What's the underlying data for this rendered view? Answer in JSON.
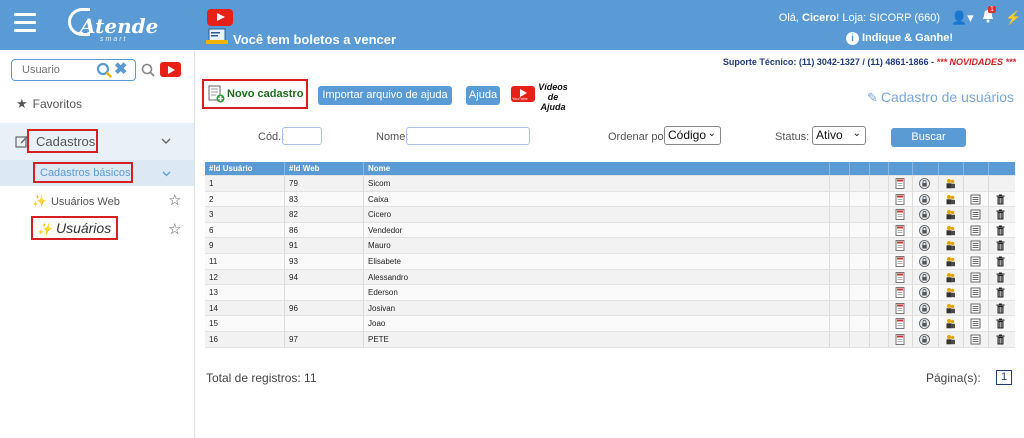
{
  "header": {
    "logo_text": "Atende",
    "logo_sub": "smart",
    "boleto_text": "Você tem boletos a vencer",
    "greeting_prefix": "Olá,",
    "user_name": "Cicero",
    "greeting_suffix": "! Loja: SICORP (660)",
    "notification_count": "1",
    "indique_text": "Indique & Ganhe!"
  },
  "sidebar": {
    "search_placeholder": "Usuario",
    "favoritos": "Favoritos",
    "cadastros": "Cadastros",
    "cadastros_basicos": "Cadastros básicos",
    "items": [
      {
        "label": "Usuários Web"
      },
      {
        "label": "Usuários"
      }
    ]
  },
  "support": {
    "text": "Suporte Técnico: (11) 3042-1327 / (11) 4861-1866 - ",
    "novidades": "*** NOVIDADES ***"
  },
  "toolbar": {
    "novo": "Novo cadastro",
    "importar": "Importar arquivo de ajuda",
    "ajuda": "Ajuda",
    "videos_line1": "Vídeos",
    "videos_line2": "de Ajuda",
    "youtube": "YouTube"
  },
  "page_title": "Cadastro de usuários",
  "filters": {
    "cod_label": "Cód.:",
    "cod_value": "",
    "nome_label": "Nome:",
    "nome_value": "",
    "ordenar_label": "Ordenar por:",
    "ordenar_value": "Código",
    "status_label": "Status:",
    "status_value": "Ativo",
    "buscar": "Buscar"
  },
  "table": {
    "columns": [
      "#Id Usuário",
      "#Id Web",
      "Nome"
    ],
    "rows": [
      {
        "id": "1",
        "web": "79",
        "nome": "Sicom",
        "full": false
      },
      {
        "id": "2",
        "web": "83",
        "nome": "Caixa",
        "full": true
      },
      {
        "id": "3",
        "web": "82",
        "nome": "Cicero",
        "full": true
      },
      {
        "id": "6",
        "web": "86",
        "nome": "Vendedor",
        "full": true
      },
      {
        "id": "9",
        "web": "91",
        "nome": "Mauro",
        "full": true
      },
      {
        "id": "11",
        "web": "93",
        "nome": "Elisabete",
        "full": true
      },
      {
        "id": "12",
        "web": "94",
        "nome": "Alessandro",
        "full": true
      },
      {
        "id": "13",
        "web": "",
        "nome": "Ederson",
        "full": true
      },
      {
        "id": "14",
        "web": "96",
        "nome": "Josivan",
        "full": true
      },
      {
        "id": "15",
        "web": "",
        "nome": "Joao",
        "full": true
      },
      {
        "id": "16",
        "web": "97",
        "nome": "PETE",
        "full": true
      }
    ]
  },
  "footer": {
    "total_label": "Total de registros: 11",
    "pagina_label": "Página(s):",
    "pagina_current": "1"
  },
  "colors": {
    "topbar": "#5b9bd5",
    "highlight": "#d42020"
  }
}
